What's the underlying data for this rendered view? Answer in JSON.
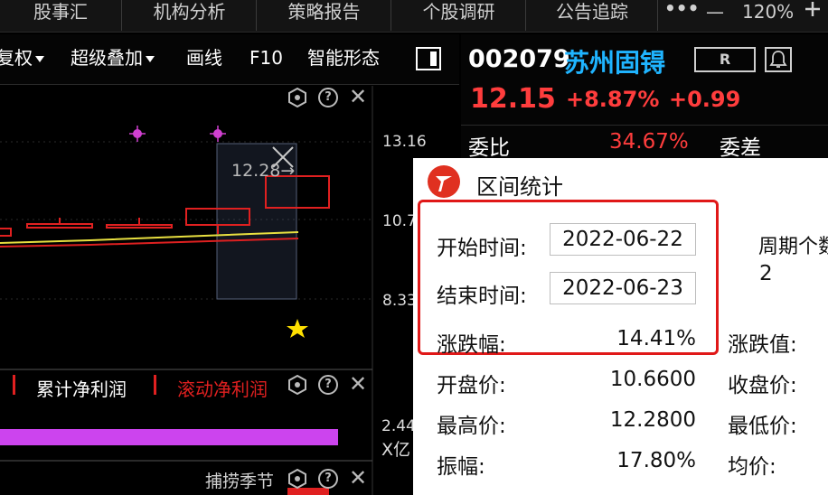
{
  "topbar": {
    "tabs": [
      "股事汇",
      "机构分析",
      "策略报告",
      "个股调研",
      "公告追踪"
    ],
    "more_label": "•••",
    "minimize_label": "—",
    "zoom": "120%"
  },
  "toolbar": {
    "items": [
      "复权",
      "超级叠加",
      "画线",
      "F10",
      "智能形态"
    ]
  },
  "chart": {
    "price_labels": [
      "13.16",
      "10.7",
      "8.33"
    ],
    "range_label": "12.28→",
    "lower_panel": {
      "legend1": "累计净利润",
      "legend2": "滚动净利润",
      "value_label": "2.44",
      "unit_label": "X亿"
    },
    "bottom_panel": {
      "title": "捕捞季节"
    }
  },
  "stock": {
    "code": "002079",
    "name": "苏州固锝",
    "r_label": "R",
    "price": "12.15",
    "change_pct": "+8.87%",
    "change_val": "+0.99",
    "ratio_label": "委比",
    "ratio_value": "34.67%",
    "diff_label": "委差"
  },
  "dialog": {
    "title": "区间统计",
    "start_label": "开始时间:",
    "start_value": "2022-06-22",
    "end_label": "结束时间:",
    "end_value": "2022-06-23",
    "change_label": "涨跌幅:",
    "change_value": "14.41%",
    "period_label": "周期个数",
    "period_value": "2",
    "change_amt_label": "涨跌值:",
    "open_label": "开盘价:",
    "open_value": "10.6600",
    "close_label": "收盘价:",
    "high_label": "最高价:",
    "high_value": "12.2800",
    "low_label": "最低价:",
    "amplitude_label": "振幅:",
    "amplitude_value": "17.80%",
    "avg_label": "均价:"
  },
  "colors": {
    "accent_red": "#ff3d3d",
    "stock_name_blue": "#1fb4ff",
    "highlight_box": "#e01818",
    "magenta_bar": "#cc44ee"
  }
}
